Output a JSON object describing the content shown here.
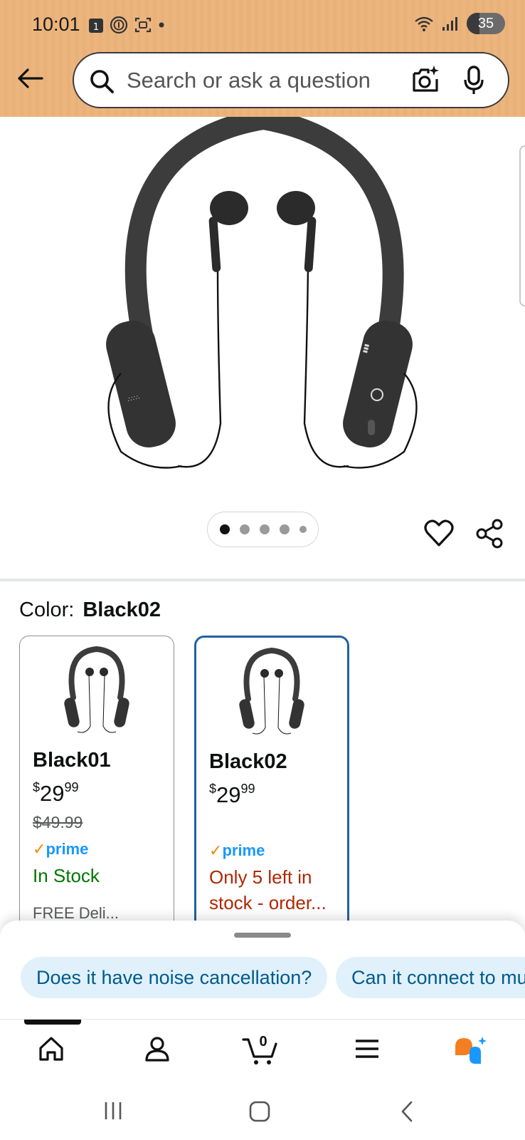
{
  "status_bar": {
    "time": "10:01",
    "battery": "35",
    "calendar_badge": "1"
  },
  "search": {
    "placeholder": "Search or ask a question"
  },
  "carousel": {
    "dot_count": 5,
    "active_index": 0
  },
  "product": {
    "color_label": "Color:",
    "color_value": "Black02"
  },
  "swatches": [
    {
      "title": "Black01",
      "price_whole": "29",
      "price_cents": "99",
      "currency": "$",
      "list_price": "$49.99",
      "prime": "prime",
      "stock": "In Stock",
      "delivery_hint": "FREE Deli...",
      "selected": false
    },
    {
      "title": "Black02",
      "price_whole": "29",
      "price_cents": "99",
      "currency": "$",
      "list_price": "",
      "prime": "prime",
      "stock": "Only 5 left in stock - order...",
      "delivery_hint": "",
      "selected": true
    }
  ],
  "suggestions": [
    "Does it have noise cancellation?",
    "Can it connect to mu"
  ],
  "nav": {
    "cart_count": "0",
    "items": [
      "home-icon",
      "account-icon",
      "cart-icon",
      "menu-icon",
      "rufus-icon"
    ]
  },
  "colors": {
    "header_bg": "#ecb57e",
    "selected_border": "#2162a1",
    "prime_blue": "#1a98ff",
    "stock_green": "#007600",
    "stock_red": "#b12704",
    "chip_bg": "#e0f1fb"
  }
}
